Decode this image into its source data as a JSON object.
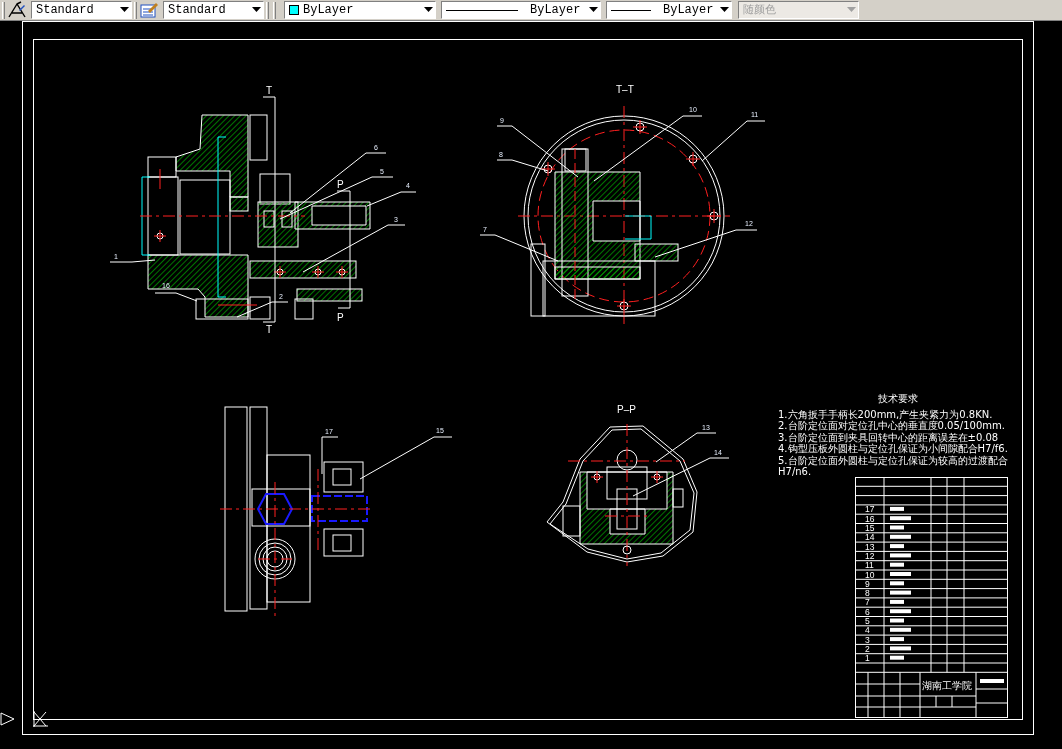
{
  "toolbar": [
    {
      "kind": "text_style",
      "label": "Standard",
      "disabled": false
    },
    {
      "kind": "dim_style",
      "label": "Standard",
      "disabled": false
    },
    {
      "kind": "color",
      "label": "ByLayer",
      "color": "#00ffff",
      "disabled": false
    },
    {
      "kind": "linetype",
      "label": "ByLayer",
      "disabled": false
    },
    {
      "kind": "lineweight",
      "label": "ByLayer",
      "disabled": false
    },
    {
      "kind": "plot_style",
      "label": "随颜色",
      "disabled": true
    }
  ],
  "drawing": {
    "section_marks": [
      "T",
      "T",
      "P",
      "P"
    ],
    "view_titles": [
      "T–T",
      "P–P"
    ],
    "balloons": [
      "1",
      "16",
      "2",
      "6",
      "5",
      "4",
      "3",
      "9",
      "8",
      "7",
      "10",
      "11",
      "12",
      "17",
      "15",
      "13",
      "14"
    ],
    "notes": {
      "title": "技术要求",
      "lines": [
        "1.六角扳手手柄长200mm,产生夹紧力为0.8KN.",
        "2.台阶定位面对定位孔中心的垂直度0.05/100mm.",
        "3.台阶定位面到夹具回转中心的距离误差在±0.08",
        "4.钩型压板外圆柱与定位孔保证为小间隙配合H7/f6.",
        "5.台阶定位面外圆柱与定位孔保证为较高的过渡配合H7/n6."
      ]
    },
    "title_block": {
      "part_numbers": [
        "17",
        "16",
        "15",
        "14",
        "13",
        "12",
        "11",
        "10",
        "9",
        "8",
        "7",
        "6",
        "5",
        "4",
        "3",
        "2",
        "1"
      ],
      "school": "湖南工学院"
    }
  }
}
